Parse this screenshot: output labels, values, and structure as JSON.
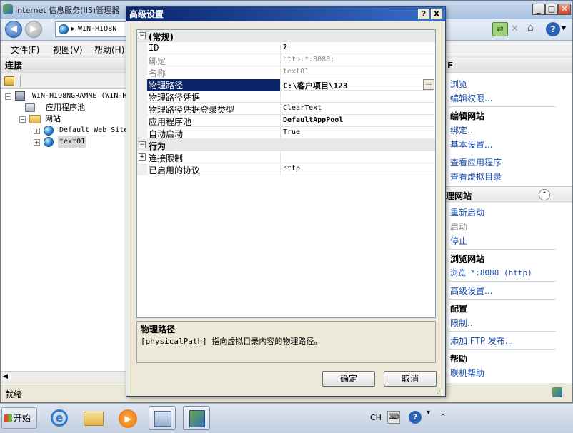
{
  "window": {
    "title": "Internet 信息服务(IIS)管理器",
    "address_path": "WIN-HIO8N"
  },
  "menu": [
    "文件(F)",
    "视图(V)",
    "帮助(H)"
  ],
  "connections": {
    "header": "连接",
    "tree": [
      {
        "label": "WIN-HIO8NGRAMNE (WIN-H"
      },
      {
        "label": "应用程序池"
      },
      {
        "label": "网站"
      },
      {
        "label": "Default Web Site"
      },
      {
        "label": "text01"
      }
    ]
  },
  "status": "就绪",
  "actions": {
    "header_fragment": "F",
    "links_top": [
      "浏览",
      "编辑权限..."
    ],
    "edit_site": {
      "title": "编辑网站",
      "items": [
        "绑定...",
        "基本设置...",
        "查看应用程序",
        "查看虚拟目录"
      ]
    },
    "manage_site": {
      "title": "理网站",
      "items": [
        "重新启动",
        "启动",
        "停止"
      ]
    },
    "browse_site": {
      "title": "浏览网站",
      "items": [
        "浏览 *:8088 (http)"
      ]
    },
    "advanced": "高级设置...",
    "config": {
      "title": "配置",
      "items": [
        "限制..."
      ]
    },
    "ftp": "添加 FTP 发布...",
    "help": {
      "title": "帮助",
      "items": [
        "联机帮助"
      ]
    }
  },
  "dialog": {
    "title": "高级设置",
    "help_btn": "?",
    "close_btn": "X",
    "categories": {
      "general": "(常规)",
      "behavior": "行为"
    },
    "properties": [
      {
        "key": "ID",
        "value": "2"
      },
      {
        "key": "绑定",
        "value": "http:*:8088:"
      },
      {
        "key": "名称",
        "value": "text01"
      },
      {
        "key": "物理路径",
        "value": "C:\\客户项目\\123"
      },
      {
        "key": "物理路径凭据",
        "value": ""
      },
      {
        "key": "物理路径凭据登录类型",
        "value": "ClearText"
      },
      {
        "key": "应用程序池",
        "value": "DefaultAppPool"
      },
      {
        "key": "自动启动",
        "value": "True"
      }
    ],
    "behavior_properties": [
      {
        "key": "连接限制",
        "value": ""
      },
      {
        "key": "已启用的协议",
        "value": "http"
      }
    ],
    "browse_btn": "...",
    "description": {
      "title": "物理路径",
      "text": "[physicalPath] 指向虚拟目录内容的物理路径。"
    },
    "ok": "确定",
    "cancel": "取消"
  },
  "taskbar": {
    "start": "开始",
    "lang": "CH"
  }
}
